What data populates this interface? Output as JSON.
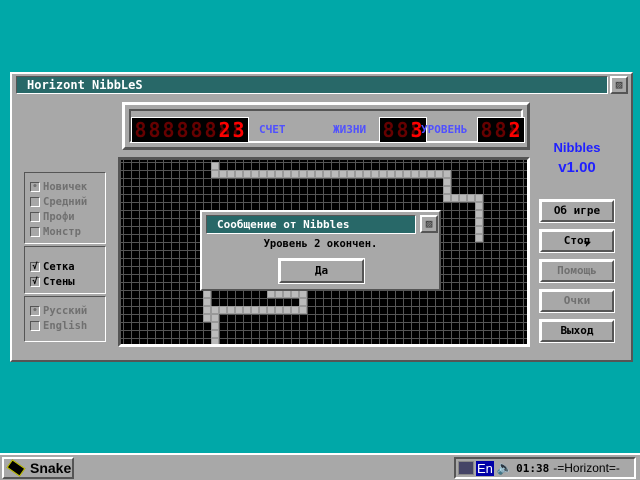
{
  "window": {
    "title": "Horizont NibbLeS"
  },
  "scoreboard": {
    "score": "23",
    "score_digits": 8,
    "score_label": "СЧЕТ",
    "lives_label": "ЖИЗНИ",
    "lives": "3",
    "lives_digits": 3,
    "level_label": "УРОВЕНЬ",
    "level": "2",
    "level_digits": 3
  },
  "difficulty": [
    {
      "label": "Новичек",
      "selected": true
    },
    {
      "label": "Средний",
      "selected": false
    },
    {
      "label": "Профи",
      "selected": false
    },
    {
      "label": "Монстр",
      "selected": false
    }
  ],
  "options": [
    {
      "label": "Сетка",
      "checked": true
    },
    {
      "label": "Стены",
      "checked": true
    }
  ],
  "language": [
    {
      "label": "Русский",
      "selected": true
    },
    {
      "label": "English",
      "selected": false
    }
  ],
  "logo": {
    "name": "Nibbles",
    "version": "v1.00"
  },
  "buttons": [
    {
      "label": "Об игре",
      "enabled": true
    },
    {
      "label": "Стоп",
      "enabled": true
    },
    {
      "label": "Помощь",
      "enabled": false
    },
    {
      "label": "Очки",
      "enabled": false
    },
    {
      "label": "Выход",
      "enabled": true
    }
  ],
  "dialog": {
    "title": "Сообщение от Nibbles",
    "message": "Уровень 2 окончен.",
    "ok_label": "Да"
  },
  "taskbar": {
    "app_label": "Snake",
    "lang": "En",
    "clock": "01:38",
    "tray_label": "-=Horizont=-"
  },
  "colors": {
    "desktop": "#00a8a8",
    "titlebar": "#286868",
    "led": "#ff0000",
    "label": "#5050ff"
  }
}
